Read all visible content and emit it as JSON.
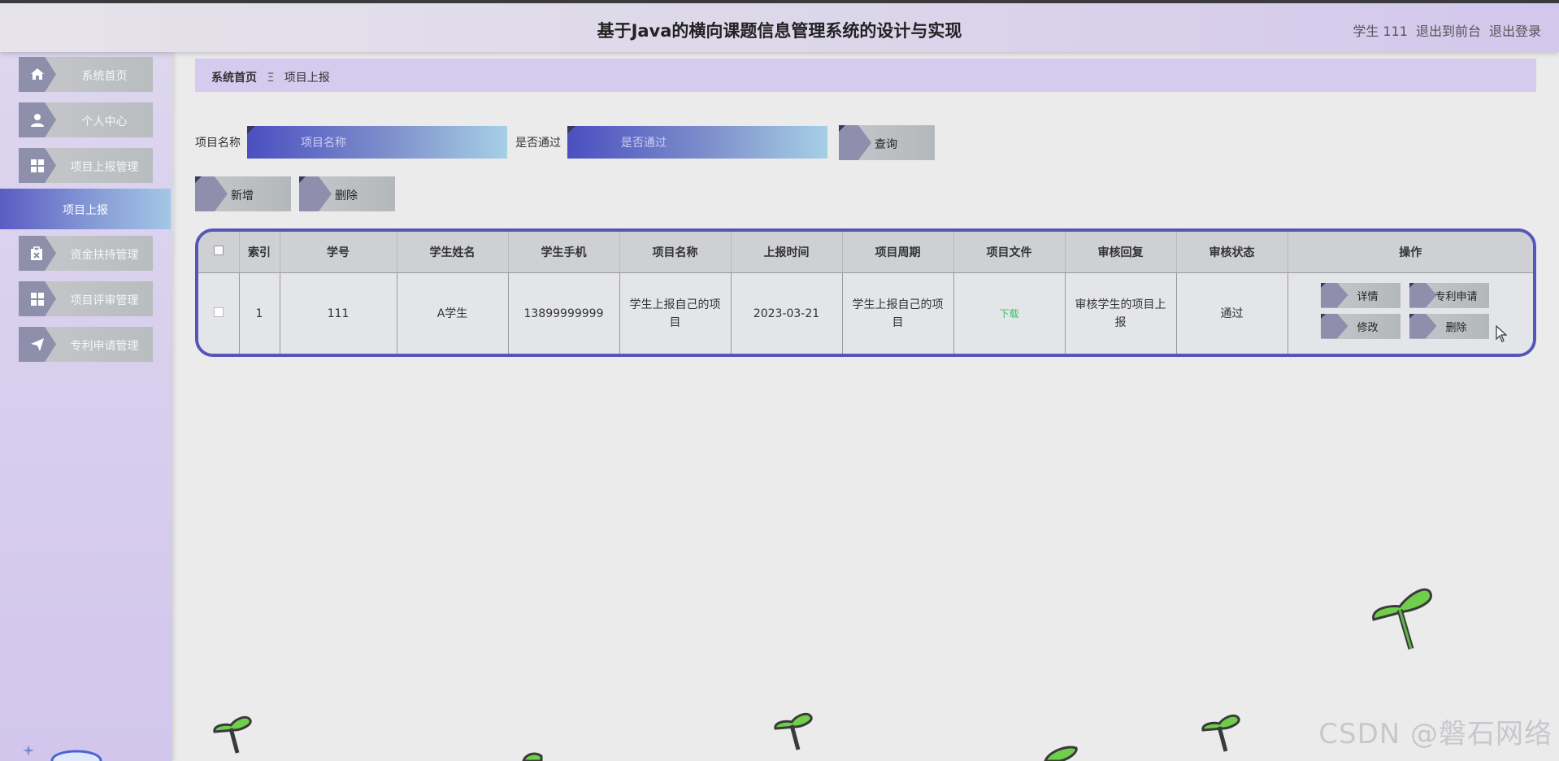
{
  "header": {
    "title": "基于Java的横向课题信息管理系统的设计与实现",
    "user": "学生 111",
    "to_front": "退出到前台",
    "logout": "退出登录"
  },
  "sidebar": {
    "items": [
      {
        "label": "系统首页",
        "icon": "home-icon"
      },
      {
        "label": "个人中心",
        "icon": "user-icon"
      },
      {
        "label": "项目上报管理",
        "icon": "grid-icon"
      },
      {
        "label": "项目上报",
        "icon": "",
        "active": true
      },
      {
        "label": "资金扶持管理",
        "icon": "clipboard-icon"
      },
      {
        "label": "项目评审管理",
        "icon": "grid-icon"
      },
      {
        "label": "专利申请管理",
        "icon": "send-icon"
      }
    ]
  },
  "breadcrumb": {
    "home": "系统首页",
    "separator": "Ξ",
    "current": "项目上报"
  },
  "search": {
    "name_label": "项目名称",
    "name_placeholder": "项目名称",
    "pass_label": "是否通过",
    "pass_placeholder": "是否通过",
    "query_button": "查询"
  },
  "toolbar": {
    "add_button": "新增",
    "delete_button": "删除"
  },
  "table": {
    "headers": [
      "",
      "索引",
      "学号",
      "学生姓名",
      "学生手机",
      "项目名称",
      "上报时间",
      "项目周期",
      "项目文件",
      "审核回复",
      "审核状态",
      "操作"
    ],
    "rows": [
      {
        "index": "1",
        "student_no": "111",
        "student_name": "A学生",
        "phone": "13899999999",
        "project_name": "学生上报自己的项目",
        "report_time": "2023-03-21",
        "cycle": "学生上报自己的项目",
        "file": "下载",
        "reply": "审核学生的项目上报",
        "status": "通过",
        "actions": {
          "detail": "详情",
          "patent": "专利申请",
          "edit": "修改",
          "delete": "删除"
        }
      }
    ]
  },
  "watermark": "CSDN @磐石网络",
  "colors": {
    "accent": "#5557b8",
    "sidebar_bg": "#d2c6ec",
    "download": "#3bbf6d"
  }
}
